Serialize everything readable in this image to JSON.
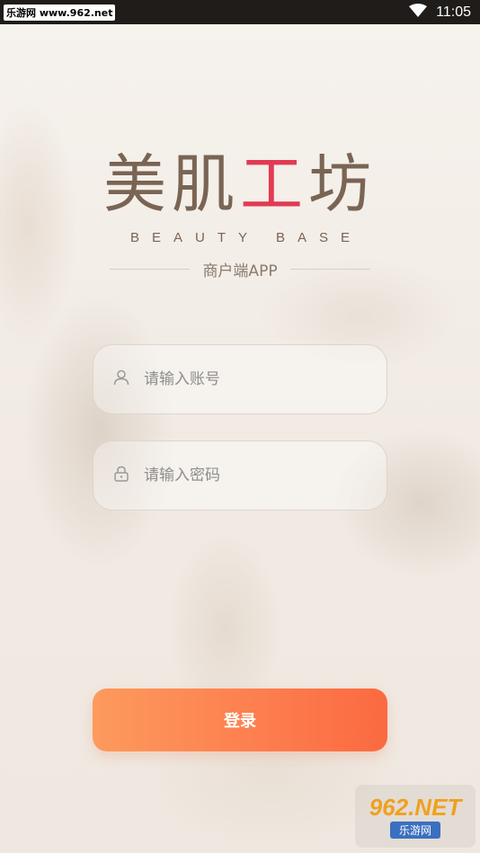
{
  "status_bar": {
    "left_text": "乐游网 www.962.net",
    "time": "11:05",
    "icons": [
      "wifi-icon",
      "signal-icon",
      "battery-icon"
    ]
  },
  "logo": {
    "chinese_text_1": "美肌",
    "chinese_text_2": "工",
    "chinese_text_3": "坊",
    "english_text": "BEAUTY BASE",
    "subtitle": "商户端APP",
    "main_color": "#7a6453",
    "accent_color": "#e23a54"
  },
  "form": {
    "account": {
      "placeholder": "请输入账号",
      "value": "",
      "icon": "user-icon"
    },
    "password": {
      "placeholder": "请输入密码",
      "value": "",
      "icon": "lock-icon"
    }
  },
  "login_button": {
    "label": "登录",
    "gradient_start": "#fd9a5d",
    "gradient_end": "#fb6a40"
  },
  "watermark": {
    "top": "962.NET",
    "bottom": "乐游网"
  }
}
